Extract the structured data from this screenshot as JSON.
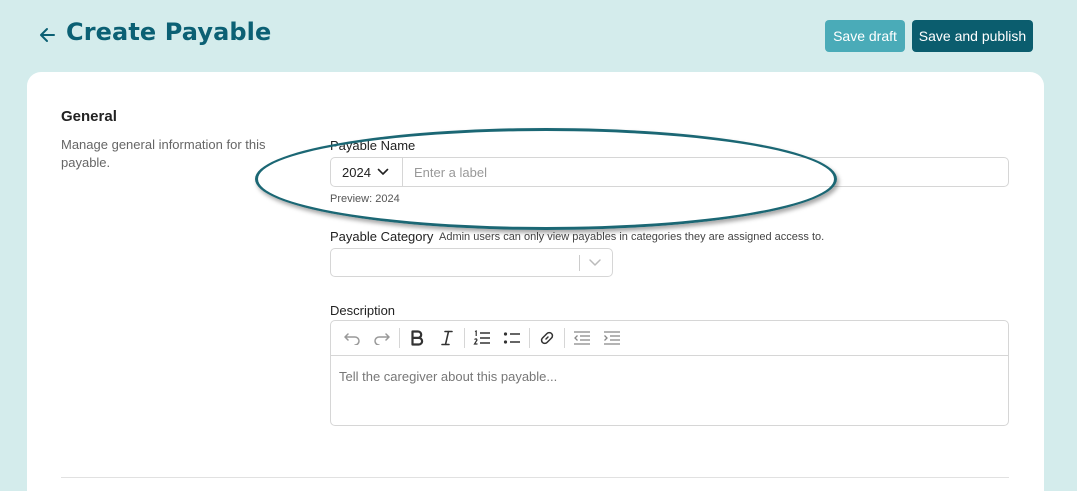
{
  "header": {
    "title": "Create Payable",
    "save_draft_label": "Save draft",
    "save_publish_label": "Save and publish"
  },
  "general": {
    "title": "General",
    "description": "Manage general information for this payable."
  },
  "payable_name": {
    "label": "Payable Name",
    "year_value": "2024",
    "placeholder": "Enter a label",
    "preview": "Preview: 2024"
  },
  "payable_category": {
    "label": "Payable Category",
    "hint": "Admin users can only view payables in categories they are assigned access to.",
    "value": ""
  },
  "description": {
    "label": "Description",
    "placeholder": "Tell the caregiver about this payable...",
    "toolbar": [
      "undo-icon",
      "redo-icon",
      "bold-icon",
      "italic-icon",
      "ordered-list-icon",
      "bullet-list-icon",
      "link-icon",
      "outdent-icon",
      "indent-icon"
    ]
  },
  "colors": {
    "background": "#d4ecec",
    "title": "#0b6074",
    "save_draft": "#4aabb8",
    "save_publish": "#0b5d6e",
    "highlight": "#1b6774"
  }
}
